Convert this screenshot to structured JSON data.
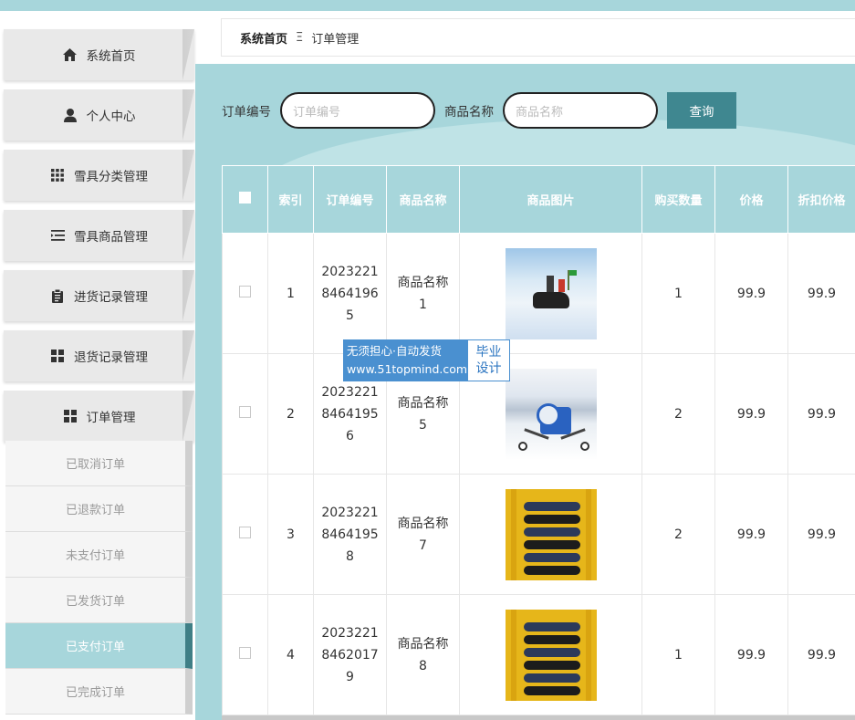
{
  "breadcrumb": {
    "home": "系统首页",
    "separator": "Ξ",
    "current": "订单管理"
  },
  "sidebar": {
    "items": [
      {
        "label": "系统首页",
        "icon": "home-icon"
      },
      {
        "label": "个人中心",
        "icon": "user-icon"
      },
      {
        "label": "雪具分类管理",
        "icon": "grid-icon"
      },
      {
        "label": "雪具商品管理",
        "icon": "list-icon"
      },
      {
        "label": "进货记录管理",
        "icon": "clipboard-icon"
      },
      {
        "label": "退货记录管理",
        "icon": "apps-icon"
      },
      {
        "label": "订单管理",
        "icon": "apps-icon"
      }
    ],
    "submenu": [
      {
        "label": "已取消订单",
        "active": false
      },
      {
        "label": "已退款订单",
        "active": false
      },
      {
        "label": "未支付订单",
        "active": false
      },
      {
        "label": "已发货订单",
        "active": false
      },
      {
        "label": "已支付订单",
        "active": true
      },
      {
        "label": "已完成订单",
        "active": false
      }
    ]
  },
  "search": {
    "order_label": "订单编号",
    "order_placeholder": "订单编号",
    "product_label": "商品名称",
    "product_placeholder": "商品名称",
    "button": "查询"
  },
  "table": {
    "headers": [
      "索引",
      "订单编号",
      "商品名称",
      "商品图片",
      "购买数量",
      "价格",
      "折扣价格"
    ],
    "rows": [
      {
        "index": "1",
        "order_no": "20232218464196 5",
        "product": "商品名称1",
        "image": "snowmobile-photo",
        "qty": "1",
        "price": "99.9",
        "discount": "99.9"
      },
      {
        "index": "2",
        "order_no": "20232218464195 6",
        "product": "商品名称5",
        "image": "snow-cannon-photo",
        "qty": "2",
        "price": "99.9",
        "discount": "99.9"
      },
      {
        "index": "3",
        "order_no": "20232218464195 8",
        "product": "商品名称7",
        "image": "board-rack-photo",
        "qty": "2",
        "price": "99.9",
        "discount": "99.9"
      },
      {
        "index": "4",
        "order_no": "20232218462017 9",
        "product": "商品名称8",
        "image": "board-rack-photo",
        "qty": "1",
        "price": "99.9",
        "discount": "99.9"
      }
    ]
  },
  "watermark": {
    "line1": "无须担心·自动发货",
    "line2": "www.51topmind.com",
    "right1": "毕业",
    "right2": "设计"
  },
  "colors": {
    "accent": "#a7d6db",
    "button": "#3f8790",
    "active_sub": "#a7d6db"
  }
}
